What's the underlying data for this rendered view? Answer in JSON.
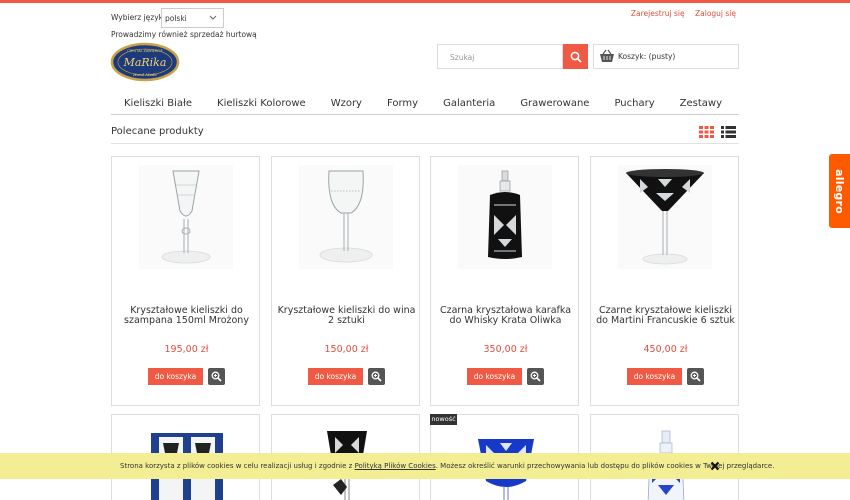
{
  "header": {
    "language_label": "Wybierz język",
    "language_value": "polski",
    "wholesale_note": "Prowadzimy również sprzedaż hurtową",
    "logo_text": "MaRika",
    "logo_top": "CRYSTAL ZAWIERCIE",
    "logo_bottom": "Hand Made",
    "register": "Zarejestruj się",
    "login": "Zaloguj się",
    "search_placeholder": "Szukaj",
    "cart": "Koszyk: (pusty)"
  },
  "nav": [
    "Kieliszki Białe",
    "Kieliszki Kolorowe",
    "Wzory",
    "Formy",
    "Galanteria",
    "Grawerowane",
    "Puchary",
    "Zestawy"
  ],
  "section": {
    "title": "Polecane produkty"
  },
  "side_tab": "allegro",
  "products": [
    {
      "name": "Kryształowe kieliszki do szampana 150ml Mrożony",
      "price": "195,00 zł",
      "add": "do koszyka"
    },
    {
      "name": "Kryształowe kieliszki do wina 2 sztuki",
      "price": "150,00 zł",
      "add": "do koszyka"
    },
    {
      "name": "Czarna kryształowa karafka do Whisky Krata Oliwka",
      "price": "350,00 zł",
      "add": "do koszyka"
    },
    {
      "name": "Czarne kryształowe kieliszki do Martini Francuskie 6 sztuk",
      "price": "450,00 zł",
      "add": "do koszyka"
    }
  ],
  "badge_new": "nowość",
  "cookie": {
    "text_before": "Strona korzysta z plików cookies w celu realizacji usług i zgodnie z ",
    "link": "Polityką Plików Cookies",
    "text_after": ". Możesz określić warunki przechowywania lub dostępu do plików cookies w Twojej przeglądarce."
  },
  "colors": {
    "accent": "#f05a44",
    "allegro": "#ff5a00",
    "cookie_bg": "#f3ee94"
  }
}
